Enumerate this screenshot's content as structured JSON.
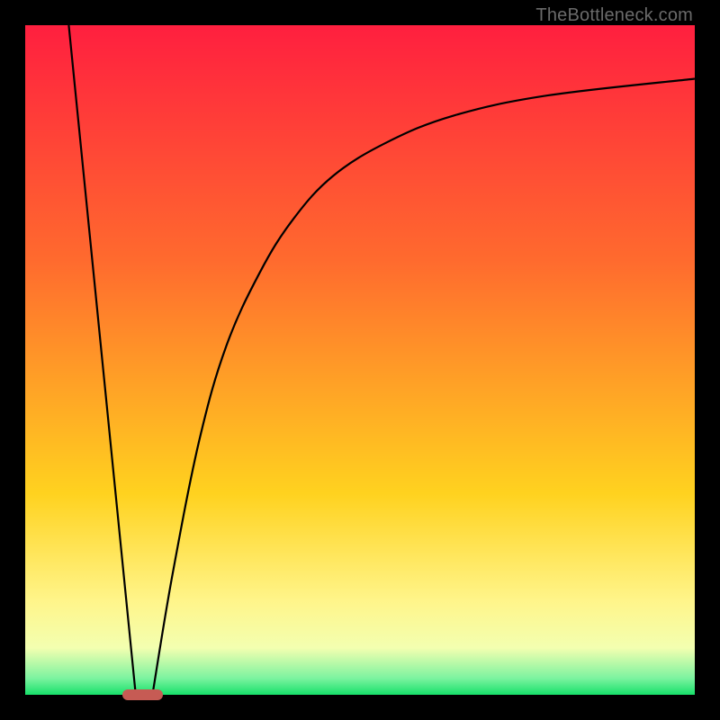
{
  "watermark": "TheBottleneck.com",
  "colors": {
    "gradient": [
      "#ff1f3f",
      "#ff6a2e",
      "#ffd21f",
      "#fff58a",
      "#f3ffb0",
      "#7df3a0",
      "#17e06a"
    ],
    "curve": "#000000",
    "marker": "#c65b54",
    "frame": "#000000"
  },
  "chart_data": {
    "type": "line",
    "title": "",
    "xlabel": "",
    "ylabel": "",
    "xlim": [
      0,
      100
    ],
    "ylim": [
      0,
      100
    ],
    "axes_visible": false,
    "gradient_meaning": "vertical bottleneck severity (top=red=high, bottom=green=none)",
    "series": [
      {
        "name": "left-leg",
        "x": [
          6.5,
          16.5
        ],
        "y": [
          100,
          0
        ]
      },
      {
        "name": "right-curve",
        "x": [
          19,
          22,
          26,
          30,
          35,
          40,
          46,
          54,
          64,
          78,
          100
        ],
        "y": [
          0,
          18,
          38,
          52,
          63,
          71,
          77.5,
          82.5,
          86.5,
          89.5,
          92
        ]
      }
    ],
    "marker": {
      "name": "optimum-range",
      "x_start": 14.5,
      "x_end": 20.5,
      "y": 0
    }
  }
}
